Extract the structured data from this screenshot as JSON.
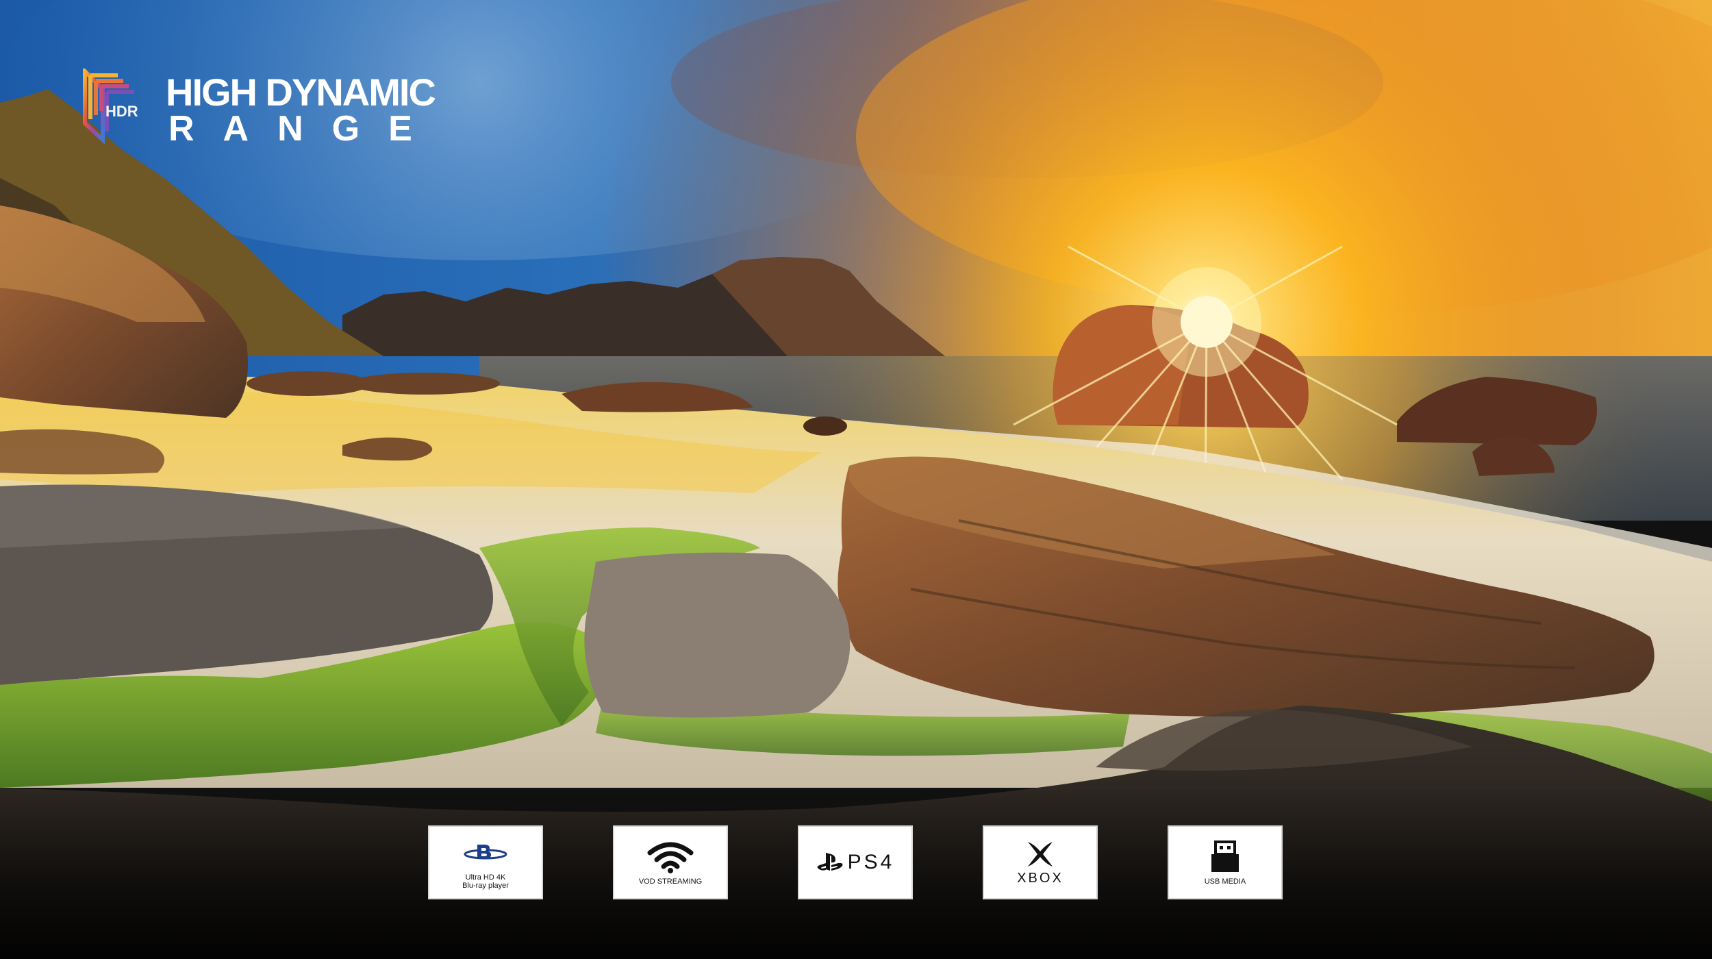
{
  "branding": {
    "badge_text": "HDR",
    "title_line1": "HIGH DYNAMIC",
    "title_line2": "RANGE"
  },
  "sources": [
    {
      "id": "bluray",
      "icon": "bluray-disc-icon",
      "label_line1": "Ultra HD 4K",
      "label_line2": "Blu-ray player"
    },
    {
      "id": "vod",
      "icon": "wifi-icon",
      "label_line1": "VOD STREAMING",
      "label_line2": ""
    },
    {
      "id": "ps4",
      "icon": "playstation-icon",
      "label_line1": "PS4",
      "label_line2": ""
    },
    {
      "id": "xbox",
      "icon": "xbox-icon",
      "label_line1": "XBOX",
      "label_line2": ""
    },
    {
      "id": "usb",
      "icon": "usb-icon",
      "label_line1": "USB MEDIA",
      "label_line2": ""
    }
  ],
  "colors": {
    "sky_top": "#1f5fae",
    "sun_glow": "#ffc21a",
    "sand": "#e9dcc0",
    "moss": "#7fb332",
    "tile_bg": "#ffffff"
  }
}
